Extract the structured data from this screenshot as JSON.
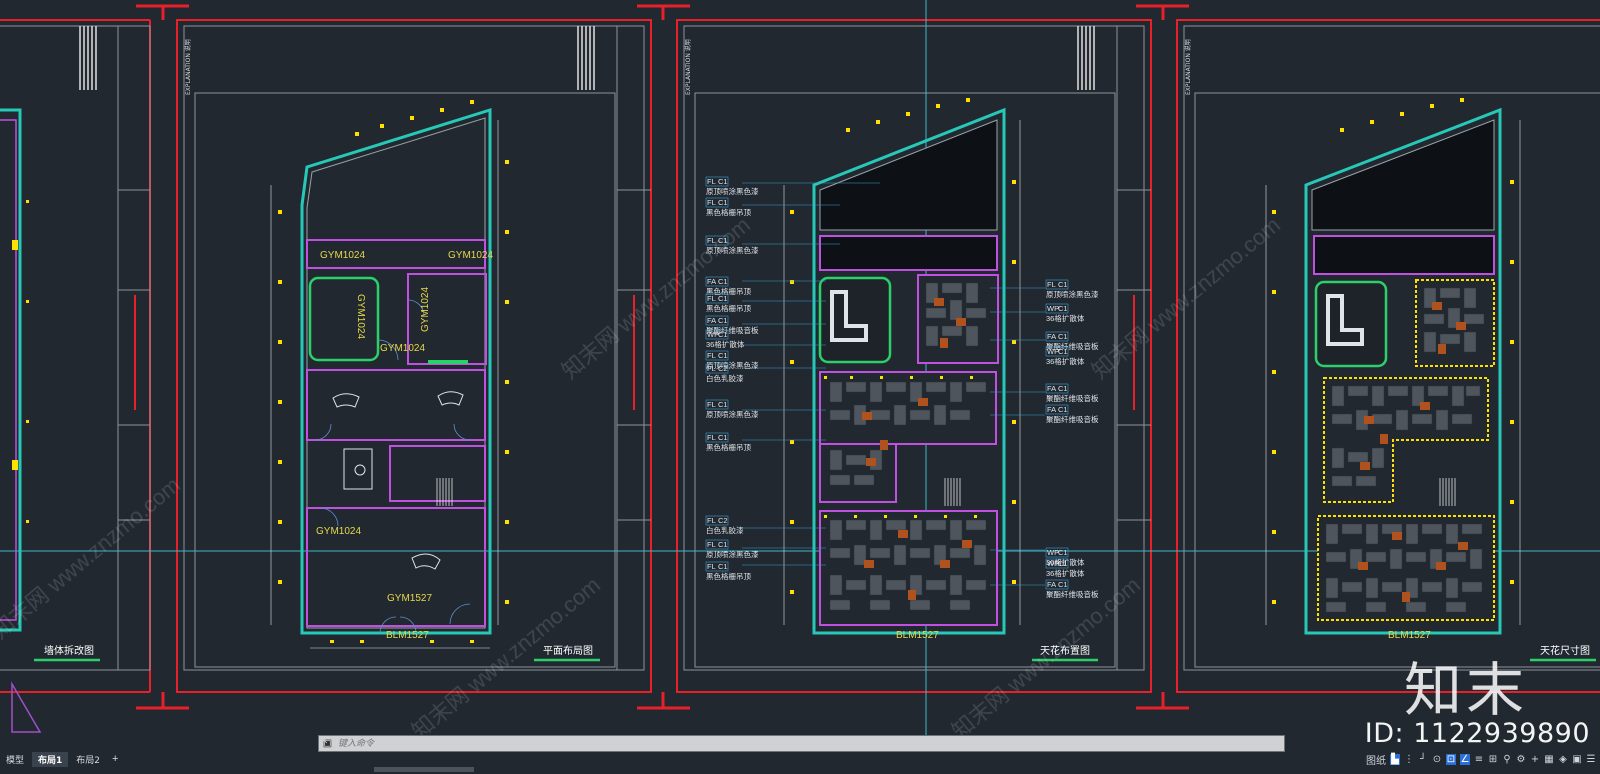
{
  "drawing": {
    "layouts": [
      {
        "title": "墙体拆改图"
      },
      {
        "title": "平面布局图"
      },
      {
        "title": "天花布置图"
      },
      {
        "title": "天花尺寸图"
      }
    ],
    "side_note": "EXPLANATION 说明",
    "door_labels": [
      "GYM1024",
      "GYM1024",
      "GYM1024",
      "GYM1024",
      "GYM1024",
      "GYM1527",
      "BLM1527"
    ],
    "ceiling_legend_left": [
      {
        "code": "FL",
        "sub": "C1",
        "text": "原顶喷涂黑色漆"
      },
      {
        "code": "FL",
        "sub": "C1",
        "text": "黑色格栅吊顶"
      },
      {
        "code": "FL",
        "sub": "C1",
        "text": "原顶喷涂黑色漆"
      },
      {
        "code": "FA",
        "sub": "C1",
        "text": "黑色格栅吊顶"
      },
      {
        "code": "FL",
        "sub": "C1",
        "text": "黑色格栅吊顶"
      },
      {
        "code": "FA",
        "sub": "C1",
        "text": "聚酯纤维吸音板"
      },
      {
        "code": "WP",
        "sub": "C1",
        "text": "36格扩散体"
      },
      {
        "code": "FL",
        "sub": "C1",
        "text": "原顶喷涂黑色漆"
      },
      {
        "code": "FL",
        "sub": "C2",
        "text": "白色乳胶漆"
      },
      {
        "code": "FL",
        "sub": "C1",
        "text": "原顶喷涂黑色漆"
      },
      {
        "code": "FL",
        "sub": "C1",
        "text": "黑色格栅吊顶"
      },
      {
        "code": "FL",
        "sub": "C2",
        "text": "白色乳胶漆"
      },
      {
        "code": "FL",
        "sub": "C1",
        "text": "原顶喷涂黑色漆"
      },
      {
        "code": "FL",
        "sub": "C1",
        "text": "黑色格栅吊顶"
      }
    ],
    "ceiling_legend_right": [
      {
        "code": "FL",
        "sub": "C1",
        "text": "原顶喷涂黑色漆"
      },
      {
        "code": "WP",
        "sub": "C1",
        "text": "36格扩散体"
      },
      {
        "code": "FA",
        "sub": "C1",
        "text": "聚酯纤维吸音板"
      },
      {
        "code": "WP",
        "sub": "C1",
        "text": "36格扩散体"
      },
      {
        "code": "FA",
        "sub": "C1",
        "text": "聚酯纤维吸音板"
      },
      {
        "code": "FA",
        "sub": "C1",
        "text": "聚酯纤维吸音板"
      },
      {
        "code": "WP",
        "sub": "C1",
        "text": "36格扩散体"
      },
      {
        "code": "WP",
        "sub": "C1",
        "text": "36格扩散体"
      },
      {
        "code": "FA",
        "sub": "C1",
        "text": "聚酯纤维吸音板"
      }
    ],
    "watermark_text": "知末网 www.znzmo.com"
  },
  "command_line": {
    "placeholder": "键入命令"
  },
  "layout_tabs": [
    "模型",
    "布局1",
    "布局2"
  ],
  "active_tab": "布局1",
  "status": {
    "paper_label": "图纸",
    "id_text": "ID: 1122939890",
    "logo_text": "知末"
  },
  "colors": {
    "background": "#212830",
    "frame_red": "#e8202a",
    "wall_cyan": "#28c8b8",
    "room_magenta": "#c050e0",
    "yellow_mark": "#ffe000",
    "furniture_orange": "#b0521e"
  }
}
